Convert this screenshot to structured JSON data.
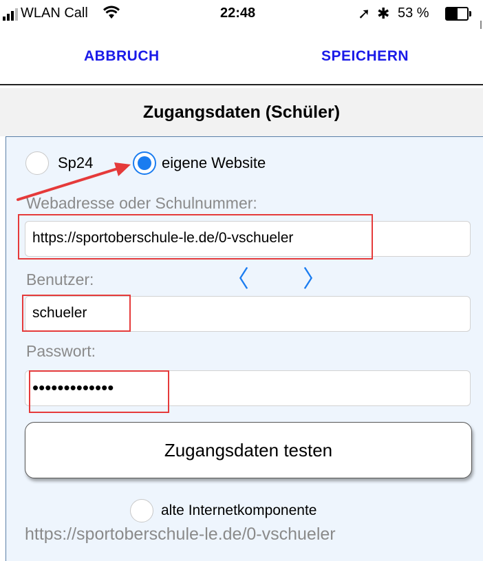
{
  "status_bar": {
    "carrier": "WLAN Call",
    "time": "22:48",
    "battery": "53 %",
    "battery_level": 0.53,
    "icons": [
      "signal-bars-icon",
      "wifi-icon",
      "location-arrow-icon",
      "bluetooth-icon",
      "battery-icon"
    ]
  },
  "nav": {
    "cancel_label": "ABBRUCH",
    "save_label": "SPEICHERN"
  },
  "section": {
    "title": "Zugangsdaten (Schüler)"
  },
  "source_options": {
    "sp24_label": "Sp24",
    "own_site_label": "eigene Website",
    "selected": "eigene Website"
  },
  "form": {
    "url_label": "Webadresse oder Schulnummer:",
    "url_value": "https://sportoberschule-le.de/0-vschueler",
    "user_label": "Benutzer:",
    "user_value": "schueler",
    "password_label": "Passwort:",
    "password_value": "•••••••••••••"
  },
  "test_button_label": "Zugangsdaten testen",
  "legacy": {
    "option_label": "alte Internetkomponente",
    "url_text": "https://sportoberschule-le.de/0-vschueler"
  },
  "colors": {
    "accent": "#1a7cf0",
    "nav_text": "#1a1ae8",
    "annotation": "#e53a3a",
    "panel_bg": "#eef5fd"
  }
}
